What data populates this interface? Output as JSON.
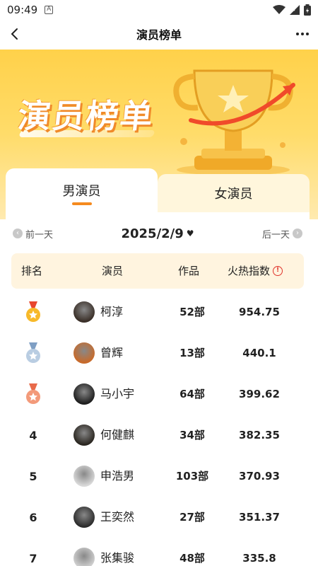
{
  "status": {
    "time": "09:49"
  },
  "nav": {
    "title": "演员榜单"
  },
  "hero": {
    "title": "演员榜单"
  },
  "tabs": [
    {
      "label": "男演员",
      "active": true
    },
    {
      "label": "女演员",
      "active": false
    }
  ],
  "date_nav": {
    "prev": "前一天",
    "date": "2025/2/9",
    "next": "后一天"
  },
  "table": {
    "headers": {
      "rank": "排名",
      "actor": "演员",
      "works": "作品",
      "heat": "火热指数"
    },
    "rows": [
      {
        "rank": "1",
        "medal": "gold",
        "name": "柯淳",
        "works": "52部",
        "heat": "954.75"
      },
      {
        "rank": "2",
        "medal": "silver",
        "name": "曾辉",
        "works": "13部",
        "heat": "440.1"
      },
      {
        "rank": "3",
        "medal": "bronze",
        "name": "马小宇",
        "works": "64部",
        "heat": "399.62"
      },
      {
        "rank": "4",
        "medal": "",
        "name": "何健麒",
        "works": "34部",
        "heat": "382.35"
      },
      {
        "rank": "5",
        "medal": "",
        "name": "申浩男",
        "works": "103部",
        "heat": "370.93"
      },
      {
        "rank": "6",
        "medal": "",
        "name": "王奕然",
        "works": "27部",
        "heat": "351.37"
      },
      {
        "rank": "7",
        "medal": "",
        "name": "张集骏",
        "works": "48部",
        "heat": "335.8"
      }
    ]
  },
  "colors": {
    "accent": "#f58a1f",
    "gold": "#f4b72a",
    "silver": "#a9bfd6",
    "bronze": "#f0886a",
    "header_bg": "#fff4df"
  }
}
